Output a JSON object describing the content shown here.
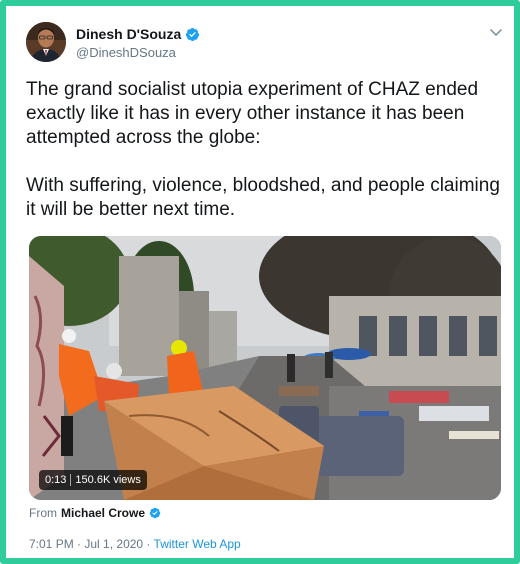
{
  "tweet": {
    "author": {
      "display_name": "Dinesh D'Souza",
      "handle": "@DineshDSouza",
      "verified": true,
      "avatar_icon": "profile-photo"
    },
    "menu_icon": "chevron-down-icon",
    "text_paragraphs": [
      "The grand socialist utopia experiment of CHAZ ended exactly like it has in every other instance it has been attempted across the globe:",
      "With suffering, violence, bloodshed, and people claiming it will be better next time."
    ],
    "media": {
      "type": "video",
      "duration": "0:13",
      "views": "150.6K views"
    },
    "attribution": {
      "prefix": "From",
      "source_name": "Michael Crowe",
      "verified": true
    },
    "timestamp": {
      "time": "7:01 PM",
      "separator": " · ",
      "date": "Jul 1, 2020",
      "client": "Twitter Web App"
    }
  },
  "colors": {
    "frame_border": "#2ecc9a",
    "verified_blue": "#1da1f2",
    "link_blue": "#1b95e0",
    "secondary_text": "#657786",
    "primary_text": "#14171a"
  }
}
